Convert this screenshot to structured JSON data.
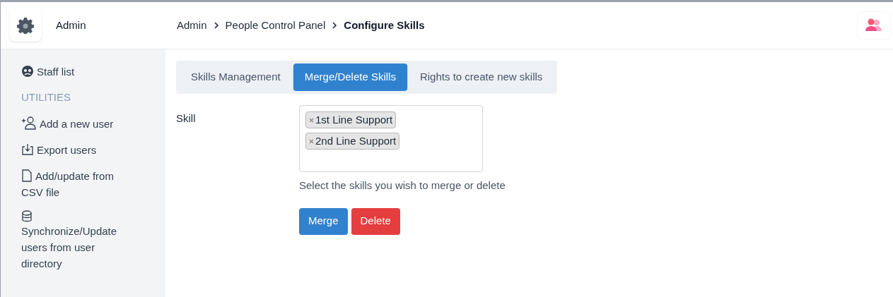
{
  "sidebar": {
    "title": "Admin",
    "items": [
      {
        "kind": "link",
        "label": "Staff list"
      },
      {
        "kind": "heading",
        "label": "UTILITIES"
      },
      {
        "kind": "link",
        "label": "Add a new user"
      },
      {
        "kind": "link",
        "label": "Export users"
      },
      {
        "kind": "link",
        "label": "Add/update from CSV file"
      },
      {
        "kind": "stacked",
        "label": "Synchronize/Update users from user directory"
      }
    ]
  },
  "breadcrumb": [
    {
      "label": "Admin",
      "current": false
    },
    {
      "label": "People Control Panel",
      "current": false
    },
    {
      "label": "Configure Skills",
      "current": true
    }
  ],
  "tabs": [
    {
      "label": "Skills Management",
      "selected": false
    },
    {
      "label": "Merge/Delete Skills",
      "selected": true
    },
    {
      "label": "Rights to create new skills",
      "selected": false
    }
  ],
  "form": {
    "label": "Skill",
    "tags": [
      "1st Line Support",
      "2nd Line Support"
    ],
    "help": "Select the skills you wish to merge or delete",
    "buttons": [
      {
        "label": "Merge",
        "kind": "primary"
      },
      {
        "label": "Delete",
        "kind": "danger"
      }
    ]
  }
}
